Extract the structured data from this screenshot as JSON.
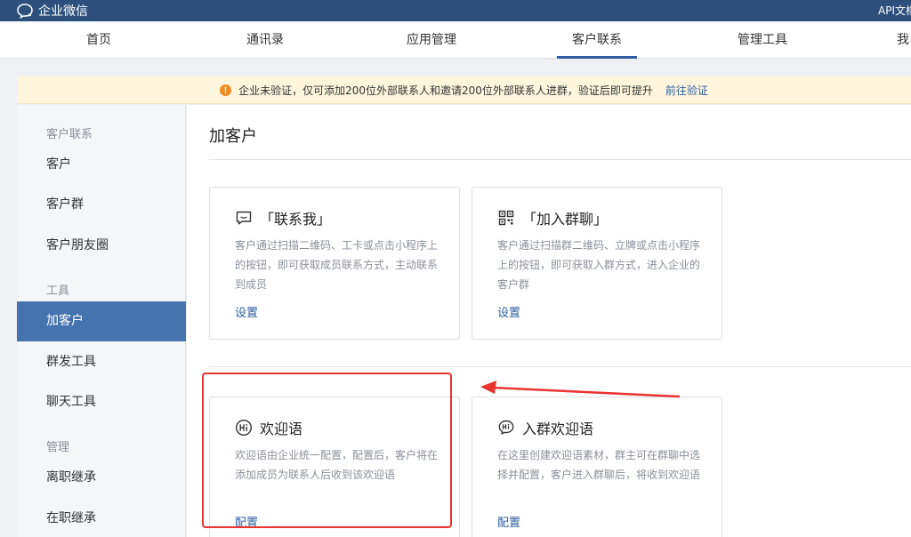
{
  "app": {
    "name": "企业微信",
    "api_link": "API文档"
  },
  "nav": [
    {
      "label": "首页",
      "active": false
    },
    {
      "label": "通讯录",
      "active": false
    },
    {
      "label": "应用管理",
      "active": false
    },
    {
      "label": "客户联系",
      "active": true
    },
    {
      "label": "管理工具",
      "active": false
    },
    {
      "label": "我",
      "active": false
    }
  ],
  "notice": {
    "text": "企业未验证，仅可添加200位外部联系人和邀请200位外部联系人进群，验证后即可提升",
    "link": "前往验证"
  },
  "sidebar": {
    "group_contacts": "客户联系",
    "group_tools": "工具",
    "group_manage": "管理",
    "items": [
      {
        "label": "客户",
        "active": false
      },
      {
        "label": "客户群",
        "active": false
      },
      {
        "label": "客户朋友圈",
        "active": false
      },
      {
        "label": "加客户",
        "active": true
      },
      {
        "label": "群发工具",
        "active": false
      },
      {
        "label": "聊天工具",
        "active": false
      },
      {
        "label": "离职继承",
        "active": false
      },
      {
        "label": "在职继承",
        "active": false
      }
    ]
  },
  "main": {
    "title": "加客户",
    "cards": [
      {
        "icon": "chat-bubble-icon",
        "title": "「联系我」",
        "desc": "客户通过扫描二维码、工卡或点击小程序上的按钮，即可获取成员联系方式，主动联系到成员",
        "link": "设置"
      },
      {
        "icon": "qr-code-icon",
        "title": "「加入群聊」",
        "desc": "客户通过扫描群二维码、立牌或点击小程序上的按钮，即可获取入群方式，进入企业的客户群",
        "link": "设置"
      },
      {
        "icon": "hi-greeting-icon",
        "title": "欢迎语",
        "desc": "欢迎语由企业统一配置，配置后，客户将在添加成员为联系人后收到该欢迎语",
        "link": "配置"
      },
      {
        "icon": "group-hi-icon",
        "title": "入群欢迎语",
        "desc": "在这里创建欢迎语素材，群主可在群聊中选择并配置，客户进入群聊后，将收到欢迎语",
        "link": "配置"
      }
    ]
  },
  "colors": {
    "topbar": "#2d4f7c",
    "accent": "#2d5fa0",
    "sidebar_active": "#4573ad",
    "notice_bg": "#fdf6dd",
    "annotation": "#e8332f"
  }
}
